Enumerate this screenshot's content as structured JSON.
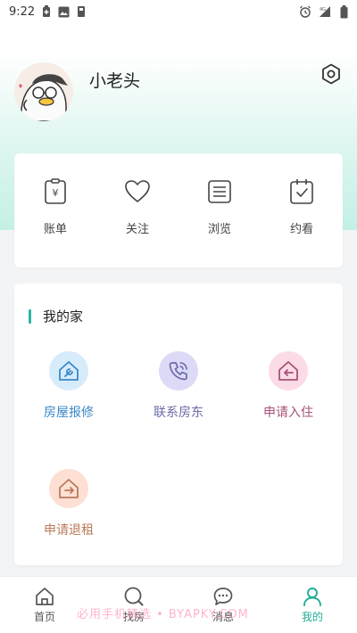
{
  "status_bar": {
    "time": "9:22",
    "network": "4G"
  },
  "profile": {
    "username": "小老头"
  },
  "quick_actions": [
    {
      "label": "账单",
      "icon": "bill-icon"
    },
    {
      "label": "关注",
      "icon": "heart-icon"
    },
    {
      "label": "浏览",
      "icon": "browse-icon"
    },
    {
      "label": "约看",
      "icon": "calendar-check-icon"
    }
  ],
  "my_home": {
    "title": "我的家",
    "items": [
      {
        "label": "房屋报修",
        "icon": "house-repair-icon",
        "color": "#3a88c8",
        "bg": "#dceefb"
      },
      {
        "label": "联系房东",
        "icon": "phone-icon",
        "color": "#6a6aa8",
        "bg": "#e4e3f7"
      },
      {
        "label": "申请入住",
        "icon": "house-enter-icon",
        "color": "#a8527a",
        "bg": "#fbe1ea"
      },
      {
        "label": "申请退租",
        "icon": "house-exit-icon",
        "color": "#b97a5a",
        "bg": "#fde4d8"
      }
    ]
  },
  "tabbar": {
    "tabs": [
      {
        "label": "首页",
        "icon": "home-icon"
      },
      {
        "label": "找房",
        "icon": "search-house-icon"
      },
      {
        "label": "消息",
        "icon": "message-icon"
      },
      {
        "label": "我的",
        "icon": "profile-icon"
      }
    ],
    "active_color": "#1fae98"
  },
  "watermark": "必用手机精选 • BYAPKY.COM"
}
